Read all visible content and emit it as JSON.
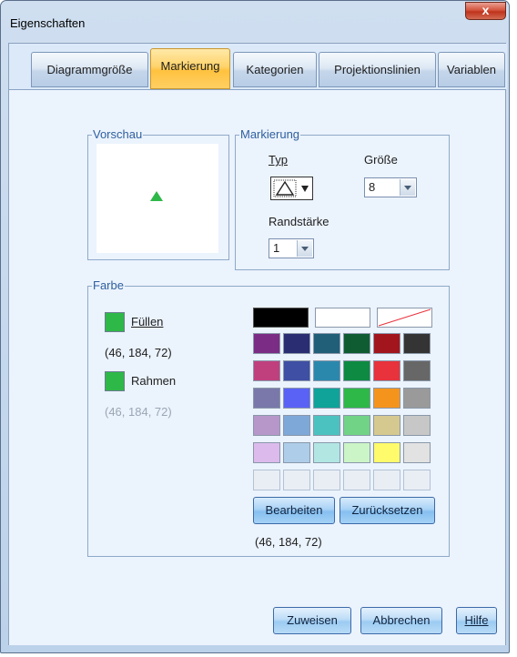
{
  "window": {
    "title": "Eigenschaften",
    "close_glyph": "x"
  },
  "tabs": [
    {
      "label": "Diagrammgröße",
      "active": false
    },
    {
      "label": "Markierung",
      "active": true
    },
    {
      "label": "Kategorien",
      "active": false
    },
    {
      "label": "Projektionslinien",
      "active": false
    },
    {
      "label": "Variablen",
      "active": false
    }
  ],
  "preview": {
    "legend": "Vorschau",
    "marker_color": "#2eb848",
    "marker_icon": "triangle-icon"
  },
  "marker": {
    "legend": "Markierung",
    "type_label": "Typ",
    "type_icon": "triangle-outline-icon",
    "size_label": "Größe",
    "size_value": "8",
    "border_width_label": "Randstärke",
    "border_width_value": "1"
  },
  "color": {
    "legend": "Farbe",
    "fill_label": "Füllen",
    "fill_color": "#2eb848",
    "fill_rgb": "(46, 184, 72)",
    "border_label": "Rahmen",
    "border_color": "#2eb848",
    "border_rgb": "(46, 184, 72)",
    "edit_button": "Bearbeiten",
    "reset_button": "Zurücksetzen",
    "selected_rgb": "(46, 184, 72)",
    "palette_top": [
      "#000000",
      "#ffffff",
      "none"
    ],
    "palette": [
      [
        "#7b2c85",
        "#2b2d72",
        "#215f78",
        "#0f5c33",
        "#a3151d",
        "#343434"
      ],
      [
        "#c0407e",
        "#3f4fa4",
        "#2b88ad",
        "#0e8a42",
        "#e8323c",
        "#676767"
      ],
      [
        "#7a78aa",
        "#5a62f6",
        "#0fa399",
        "#2eb848",
        "#f5941d",
        "#9a9a9a"
      ],
      [
        "#b797c9",
        "#7ea8d8",
        "#4cc2c0",
        "#71d386",
        "#d6c990",
        "#c7c7c7"
      ],
      [
        "#dcbaec",
        "#aecde9",
        "#b2e6e3",
        "#ccf5c7",
        "#fffb6b",
        "#e2e2e2"
      ],
      [
        "#e9eef5",
        "#e9eef5",
        "#e9eef5",
        "#e9eef5",
        "#e9eef5",
        "#e9eef5"
      ]
    ]
  },
  "footer": {
    "apply_button": "Zuweisen",
    "cancel_button": "Abbrechen",
    "help_button": "Hilfe"
  }
}
